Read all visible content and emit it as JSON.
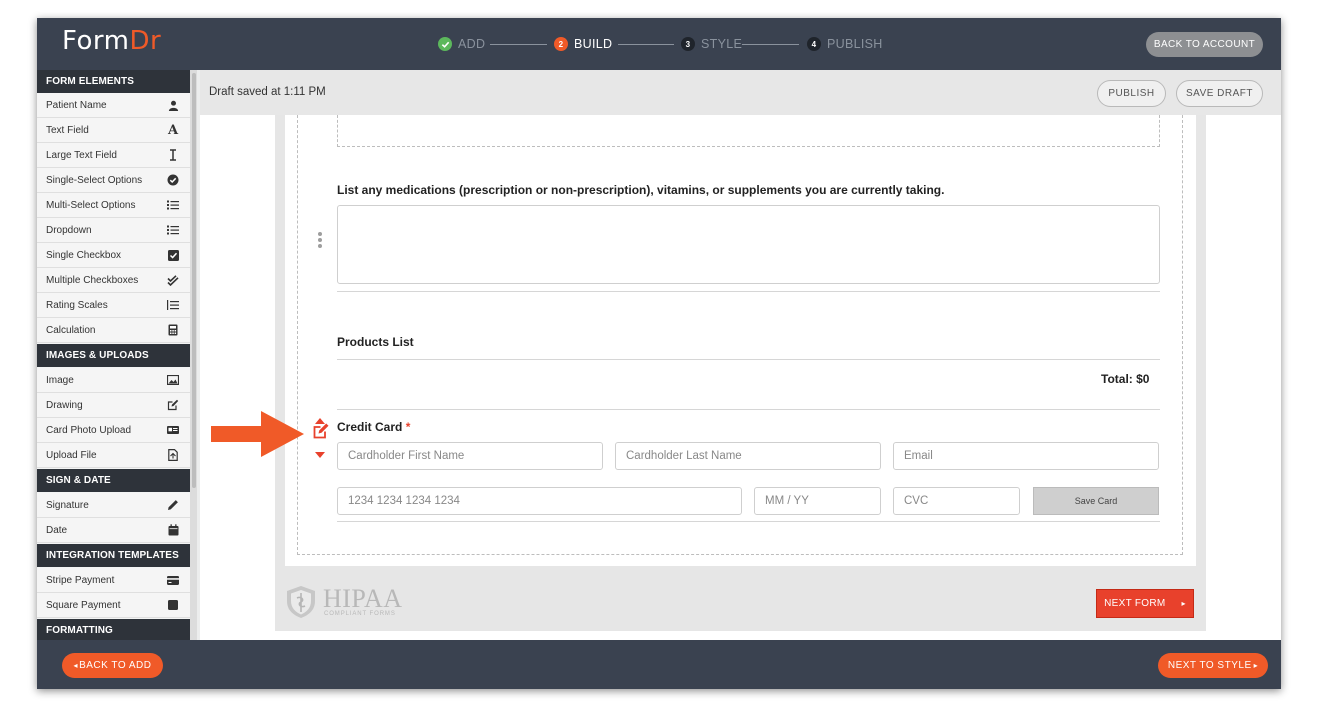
{
  "header": {
    "logo_form": "Form",
    "logo_dr": "Dr",
    "steps": [
      {
        "num": "✓",
        "label": "ADD"
      },
      {
        "num": "2",
        "label": "BUILD"
      },
      {
        "num": "3",
        "label": "STYLE"
      },
      {
        "num": "4",
        "label": "PUBLISH"
      }
    ],
    "back_to_account": "BACK TO ACCOUNT"
  },
  "sidebar": {
    "sections": [
      {
        "title": "FORM ELEMENTS",
        "items": [
          {
            "label": "Patient Name",
            "icon": "person-icon"
          },
          {
            "label": "Text Field",
            "icon": "letter-a-icon"
          },
          {
            "label": "Large Text Field",
            "icon": "text-cursor-icon"
          },
          {
            "label": "Single-Select Options",
            "icon": "check-circle-icon"
          },
          {
            "label": "Multi-Select Options",
            "icon": "list-icon"
          },
          {
            "label": "Dropdown",
            "icon": "list-icon"
          },
          {
            "label": "Single Checkbox",
            "icon": "checkbox-icon"
          },
          {
            "label": "Multiple Checkboxes",
            "icon": "double-check-icon"
          },
          {
            "label": "Rating Scales",
            "icon": "rating-list-icon"
          },
          {
            "label": "Calculation",
            "icon": "calculator-icon"
          }
        ]
      },
      {
        "title": "IMAGES & UPLOADS",
        "items": [
          {
            "label": "Image",
            "icon": "image-icon"
          },
          {
            "label": "Drawing",
            "icon": "edit-icon"
          },
          {
            "label": "Card Photo Upload",
            "icon": "id-card-icon"
          },
          {
            "label": "Upload File",
            "icon": "file-icon"
          }
        ]
      },
      {
        "title": "SIGN & DATE",
        "items": [
          {
            "label": "Signature",
            "icon": "pencil-icon"
          },
          {
            "label": "Date",
            "icon": "calendar-icon"
          }
        ]
      },
      {
        "title": "INTEGRATION TEMPLATES",
        "items": [
          {
            "label": "Stripe Payment",
            "icon": "credit-card-icon"
          },
          {
            "label": "Square Payment",
            "icon": "square-icon"
          }
        ]
      },
      {
        "title": "FORMATTING",
        "items": []
      }
    ]
  },
  "toolbar": {
    "draft_status": "Draft saved at 1:11 PM",
    "publish": "PUBLISH",
    "save_draft": "SAVE DRAFT"
  },
  "form": {
    "medications_label": "List any medications (prescription or non-prescription), vitamins, or supplements you are currently taking.",
    "products_label": "Products List",
    "total": "Total: $0",
    "credit_card_label": "Credit Card",
    "required_mark": "*",
    "placeholders": {
      "first_name": "Cardholder First Name",
      "last_name": "Cardholder Last Name",
      "email": "Email",
      "card_number": "1234 1234 1234 1234",
      "expiry": "MM / YY",
      "cvc": "CVC"
    },
    "save_card": "Save Card"
  },
  "footer": {
    "hipaa_title": "HIPAA",
    "hipaa_sub": "COMPLIANT FORMS",
    "next_form": "NEXT FORM",
    "back_to_add": "BACK TO ADD",
    "next_to_style": "NEXT TO STYLE"
  },
  "colors": {
    "accent": "#f05a28",
    "header_bg": "#3a4250",
    "next_form_bg": "#e8412c"
  }
}
